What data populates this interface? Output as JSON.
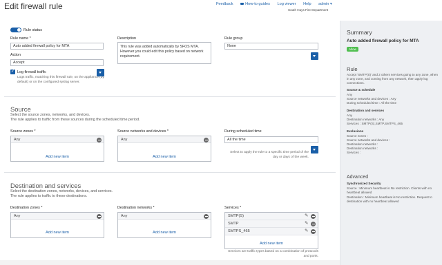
{
  "page": {
    "title": "Edit firewall rule",
    "tenant": "South Hays Fire Department"
  },
  "topnav": {
    "feedback": "Feedback",
    "howto": "How-to guides",
    "logviewer": "Log viewer",
    "help": "Help",
    "admin": "admin ▾"
  },
  "form": {
    "rule_status_label": "Rule status",
    "rule_name_label": "Rule name *",
    "rule_name_value": "Auto added firewall policy for MTA",
    "description_label": "Description",
    "description_value": "This rule was added automatically by SFOS MTA. However you could edit this policy based on network requirement.",
    "rule_group_label": "Rule group",
    "rule_group_value": "None",
    "action_label": "Action",
    "action_value": "Accept",
    "log_label": "Log firewall traffic",
    "log_help": "Logs traffic, matching this firewall rule, on the appliance (by default) or on the configured syslog server.",
    "check_glyph": "✓"
  },
  "source": {
    "title": "Source",
    "desc1": "Select the source zones, networks, and devices.",
    "desc2": "The rule applies to traffic from these sources during the scheduled time period.",
    "zones_label": "Source zones *",
    "zones_value": "Any",
    "zones_add": "Add new item",
    "networks_label": "Source networks and devices *",
    "networks_value": "Any",
    "networks_add": "Add new item",
    "schedule_label": "During scheduled time",
    "schedule_value": "All the time",
    "schedule_help": "Select to apply the rule to a specific time period of the day or days of the week."
  },
  "destination": {
    "title": "Destination and services",
    "desc1": "Select the destination zones, networks, devices, and services.",
    "desc2": "The rule applies to traffic to these destinations.",
    "zones_label": "Destination zones *",
    "zones_value": "Any",
    "zones_add": "Add new item",
    "networks_label": "Destination networks *",
    "networks_value": "Any",
    "networks_add": "Add new item",
    "services_label": "Services *",
    "services": [
      "SMTP(S)",
      "SMTP",
      "SMTPS_465"
    ],
    "services_add": "Add new item",
    "services_help": "Services are traffic types based on a combination of protocols and ports."
  },
  "sidebar": {
    "summary_title": "Summary",
    "policy_name": "Auto added firewall policy for MTA",
    "allow_badge": "Allow",
    "rule_heading": "Rule",
    "rule_text": "Accept 'SMTP(S)' and 2 others services going to any zone, when in any zone, and coming from any network, then apply log connections.",
    "src_sched_heading": "Source & schedule",
    "src_sched_lines": [
      "Any",
      "Source networks and devices : Any",
      "During scheduled time : All the time"
    ],
    "dst_svc_heading": "Destination and services",
    "dst_svc_lines": [
      "Any",
      "Destination networks : Any",
      "Services : SMTP(S),SMTP,SMTPS_465"
    ],
    "excl_heading": "Exclusions",
    "excl_lines": [
      "Source zones :",
      "Source networks and devices :",
      "Destination networks :",
      "Destination networks :",
      "Services :"
    ],
    "advanced_heading": "Advanced",
    "sync_heading": "Synchronized Security",
    "sync_lines": [
      "Source : Minimum heartbeat is No restriction. Clients with no heartbeat allowed",
      "Destination : Minimum heartbeat is No restriction. Request to destination with no heartbeat allowed"
    ]
  },
  "colors": {
    "accent": "#1a5fa8",
    "allow": "#4fbe4f",
    "sidebar_bg": "#eef0f3"
  }
}
